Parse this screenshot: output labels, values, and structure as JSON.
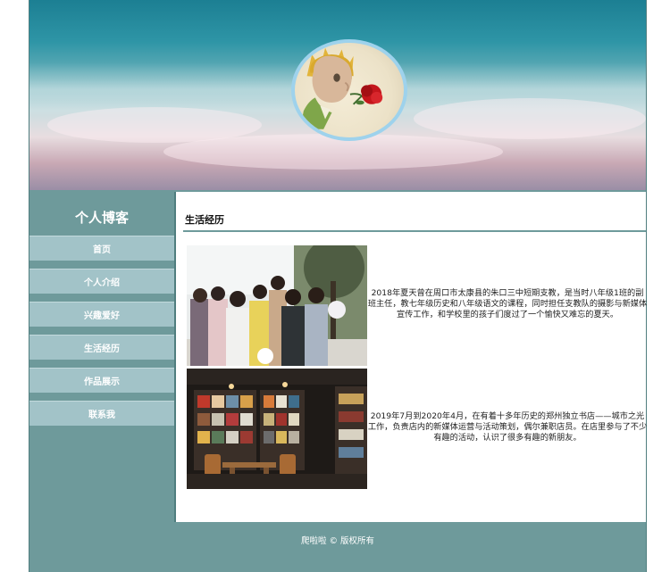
{
  "blog": {
    "title": "个人博客"
  },
  "nav": [
    {
      "label": "首页"
    },
    {
      "label": "个人介绍"
    },
    {
      "label": "兴趣爱好"
    },
    {
      "label": "生活经历"
    },
    {
      "label": "作品展示"
    },
    {
      "label": "联系我"
    }
  ],
  "section": {
    "heading": "生活经历",
    "entries": [
      {
        "text": "2018年夏天曾在周口市太康县的朱口三中短期支教，是当时八年级1班的副班主任，教七年级历史和八年级语文的课程，同时担任支教队的摄影与新媒体宣传工作，和学校里的孩子们度过了一个愉快又难忘的夏天。"
      },
      {
        "text": "2019年7月到2020年4月，在有着十多年历史的郑州独立书店——城市之光工作，负责店内的新媒体运营与活动策划，偶尔兼职店员。在店里参与了不少有趣的活动，认识了很多有趣的新朋友。"
      }
    ]
  },
  "footer": {
    "text": "爬啦啦 © 版权所有"
  },
  "colors": {
    "frame": "#6e9a9b",
    "nav_item": "#a2c3c8",
    "avatar_ring": "#9ed2ec"
  }
}
